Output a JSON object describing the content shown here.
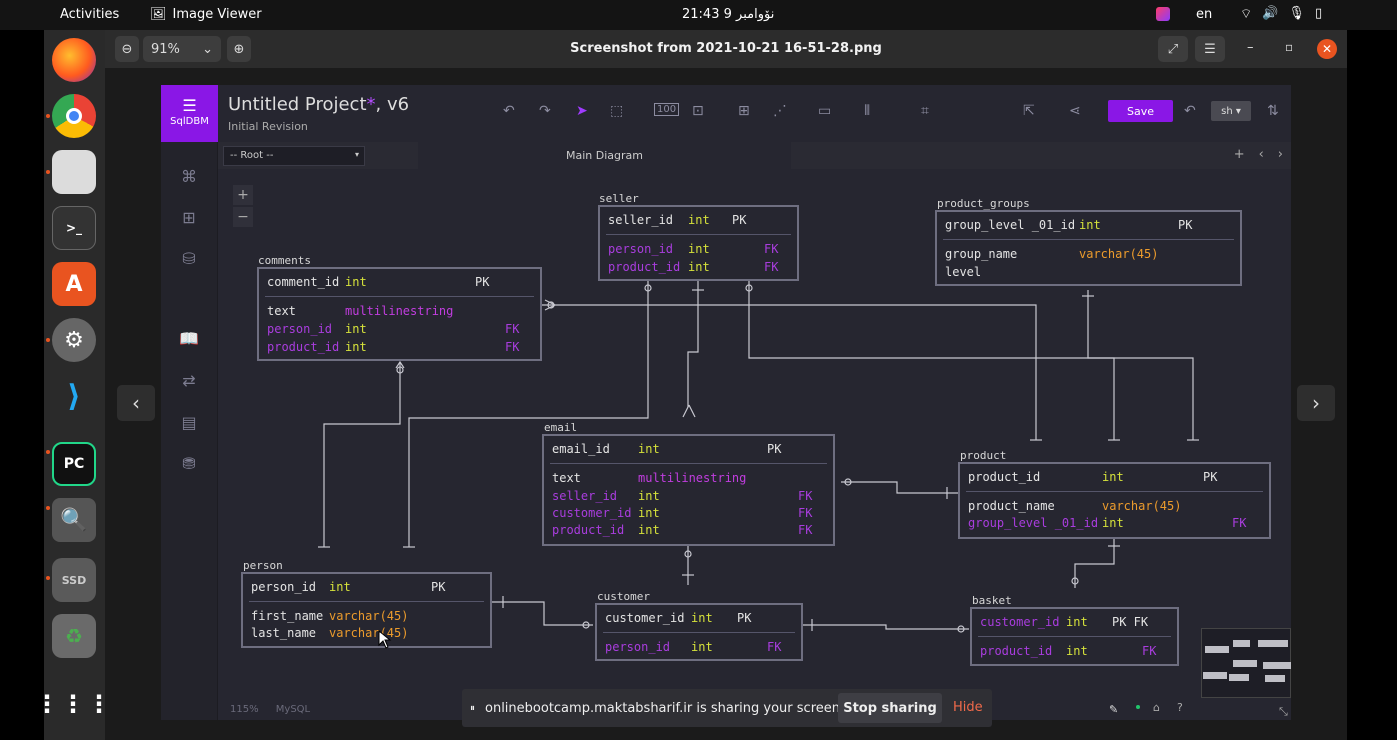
{
  "topbar": {
    "activities": "Activities",
    "app_name": "Image Viewer",
    "clock": "21:43  نۆوامبر 9",
    "language": "en"
  },
  "viewer": {
    "zoom": "91%",
    "title": "Screenshot from 2021-10-21 16-51-28.png",
    "prev_label": "‹",
    "next_label": "›"
  },
  "dock": {
    "apps": [
      "firefox-icon",
      "chrome-icon",
      "files-icon",
      "terminal-icon",
      "software-icon",
      "settings-icon",
      "vscode-icon",
      "pycharm-icon",
      "image-viewer-icon",
      "ssd-drive-icon",
      "trash-icon",
      "app-grid-icon"
    ],
    "ssd_label": "SSD",
    "pycharm_label": "PC"
  },
  "sqldbm": {
    "brand": "SqlDBM",
    "project_title": "Untitled Project",
    "project_star": "*",
    "project_version": ", v6",
    "subtitle": "Initial Revision",
    "save_label": "Save",
    "user_label": "sh ▾",
    "root_select": "-- Root --",
    "diagram_tab": "Main Diagram",
    "status_zoom": "115%",
    "status_db": "MySQL",
    "accent": "#8a17e6"
  },
  "tables": {
    "seller": {
      "name": "seller",
      "rows": [
        {
          "col": "seller_id",
          "type": "int",
          "key": "PK"
        },
        {
          "col": "person_id",
          "type": "int",
          "key": "FK"
        },
        {
          "col": "product_id",
          "type": "int",
          "key": "FK"
        }
      ]
    },
    "product_groups": {
      "name": "product_groups",
      "rows": [
        {
          "col": "group_level _01_id",
          "type": "int",
          "key": "PK"
        },
        {
          "col": "group_name",
          "type": "varchar(45)",
          "key": ""
        },
        {
          "col": "level",
          "type": "",
          "key": ""
        }
      ]
    },
    "comments": {
      "name": "comments",
      "rows": [
        {
          "col": "comment_id",
          "type": "int",
          "key": "PK"
        },
        {
          "col": "text",
          "type": "multilinestring",
          "key": ""
        },
        {
          "col": "person_id",
          "type": "int",
          "key": "FK"
        },
        {
          "col": "product_id",
          "type": "int",
          "key": "FK"
        }
      ]
    },
    "email": {
      "name": "email",
      "rows": [
        {
          "col": "email_id",
          "type": "int",
          "key": "PK"
        },
        {
          "col": "text",
          "type": "multilinestring",
          "key": ""
        },
        {
          "col": "seller_id",
          "type": "int",
          "key": "FK"
        },
        {
          "col": "customer_id",
          "type": "int",
          "key": "FK"
        },
        {
          "col": "product_id",
          "type": "int",
          "key": "FK"
        }
      ]
    },
    "product": {
      "name": "product",
      "rows": [
        {
          "col": "product_id",
          "type": "int",
          "key": "PK"
        },
        {
          "col": "product_name",
          "type": "varchar(45)",
          "key": ""
        },
        {
          "col": "group_level _01_id",
          "type": "int",
          "key": "FK"
        }
      ]
    },
    "person": {
      "name": "person",
      "rows": [
        {
          "col": "person_id",
          "type": "int",
          "key": "PK"
        },
        {
          "col": "first_name",
          "type": "varchar(45)",
          "key": ""
        },
        {
          "col": "last_name",
          "type": "varchar(45)",
          "key": ""
        }
      ]
    },
    "customer": {
      "name": "customer",
      "rows": [
        {
          "col": "customer_id",
          "type": "int",
          "key": "PK"
        },
        {
          "col": "person_id",
          "type": "int",
          "key": "FK"
        }
      ]
    },
    "basket": {
      "name": "basket",
      "rows": [
        {
          "col": "customer_id",
          "type": "int",
          "key": "PK FK"
        },
        {
          "col": "product_id",
          "type": "int",
          "key": "FK"
        }
      ]
    }
  },
  "share_bar": {
    "message": "onlinebootcamp.maktabsharif.ir is sharing your screen.",
    "stop_label": "Stop sharing",
    "hide_label": "Hide"
  }
}
